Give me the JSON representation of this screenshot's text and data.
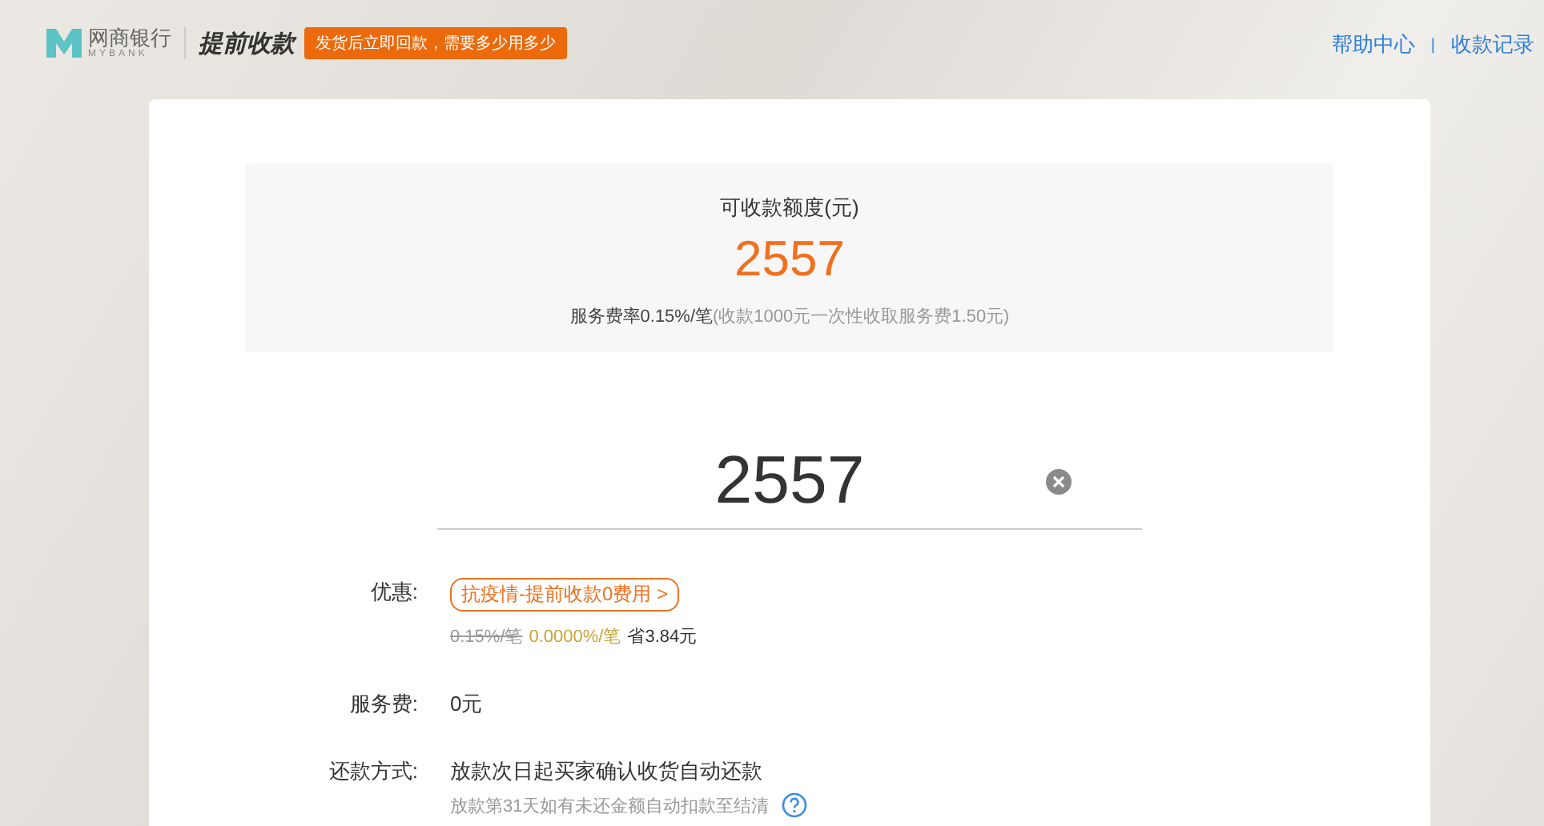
{
  "header": {
    "logo_cn": "网商银行",
    "logo_en": "MYBANK",
    "product": "提前收款",
    "tagline": "发货后立即回款，需要多少用多少",
    "links": [
      "帮助中心",
      "收款记录"
    ],
    "separator": "|"
  },
  "quota": {
    "label": "可收款额度(元)",
    "amount": "2557",
    "fee_rate": "服务费率0.15%/笔",
    "fee_note": "(收款1000元一次性收取服务费1.50元)"
  },
  "amount_input": {
    "value": "2557"
  },
  "promo": {
    "label": "优惠:",
    "tag": "抗疫情-提前收款0费用 >",
    "old_rate": "0.15%/笔",
    "new_rate": "0.0000%/笔",
    "saving": "省3.84元"
  },
  "service_fee": {
    "label": "服务费:",
    "value": "0元"
  },
  "repayment": {
    "label": "还款方式:",
    "value": "放款次日起买家确认收货自动还款",
    "note": "放款第31天如有未还金额自动扣款至结清"
  }
}
